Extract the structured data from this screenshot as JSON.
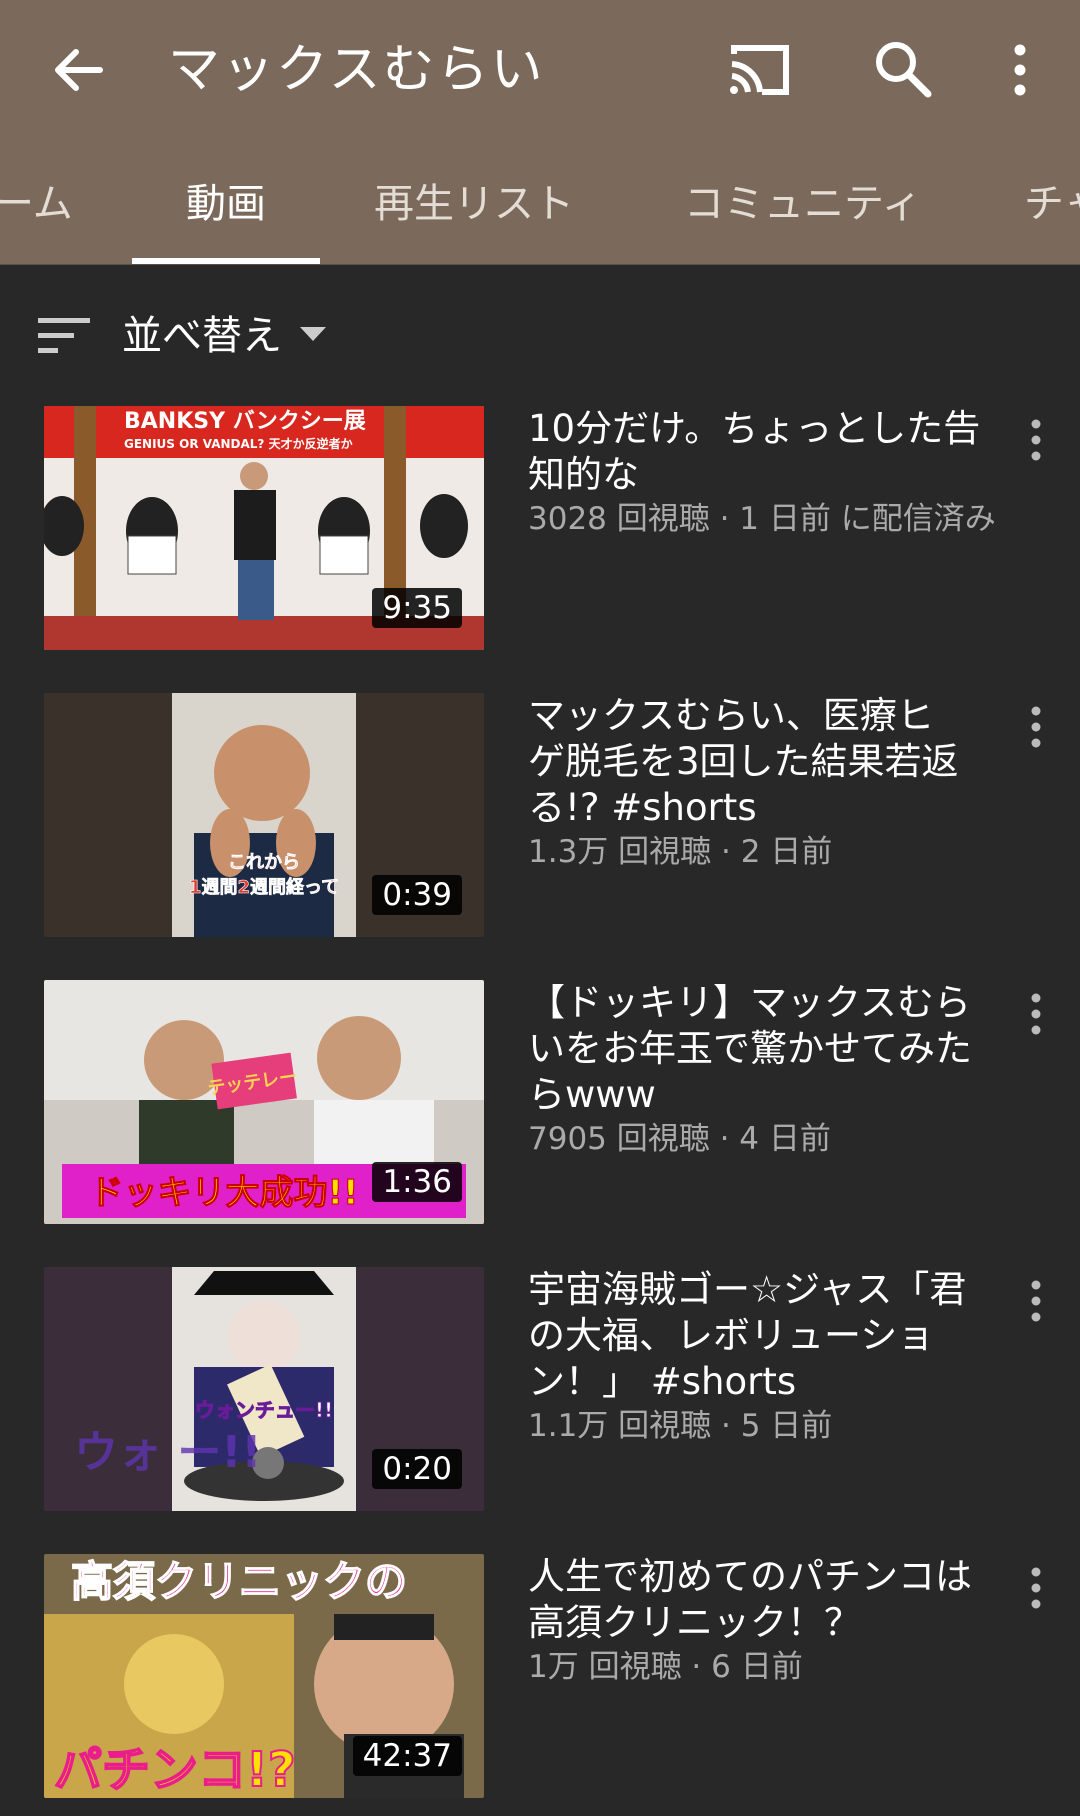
{
  "header": {
    "title": "マックスむらい",
    "bg_color": "#7b6a5b"
  },
  "tabs": [
    {
      "label": "ーム"
    },
    {
      "label": "動画"
    },
    {
      "label": "再生リスト"
    },
    {
      "label": "コミュニティ"
    },
    {
      "label": "チャ"
    }
  ],
  "active_tab": "動画",
  "sort": {
    "label": "並べ替え"
  },
  "videos": [
    {
      "title": "10分だけ。ちょっとした告知的な",
      "title_lines": [
        "10分だけ。ちょっとした告",
        "知的な"
      ],
      "meta": "3028 回視聴 · 1 日前 に配信済み",
      "duration": "9:35",
      "thumb_text_1": "BANKSY バンクシー展",
      "thumb_text_2": "GENIUS OR VANDAL? 天才か反逆者か"
    },
    {
      "title": "マックスむらい、医療ヒゲ脱毛を3回した結果若返る!? #shorts",
      "title_lines": [
        "マックスむらい、医療ヒ",
        "ゲ脱毛を3回した結果若返",
        "る!? #shorts"
      ],
      "meta": "1.3万 回視聴 · 2 日前",
      "duration": "0:39",
      "thumb_text_1": "これから",
      "thumb_text_2": "1週間2週間経って"
    },
    {
      "title": "【ドッキリ】マックスむらいをお年玉で驚かせてみたらwww",
      "title_lines": [
        "【ドッキリ】マックスむら",
        "いをお年玉で驚かせてみた",
        "らwww"
      ],
      "meta": "7905 回視聴 · 4 日前",
      "duration": "1:36",
      "thumb_text_1": "テッテレー",
      "thumb_text_2": "ドッキリ大成功!!"
    },
    {
      "title": "宇宙海賊ゴー☆ジャス「君の大福、レボリューション！」 #shorts",
      "title_lines": [
        "宇宙海賊ゴー☆ジャス「君",
        "の大福、レボリューショ",
        "ン！」 #shorts"
      ],
      "meta": "1.1万 回視聴 · 5 日前",
      "duration": "0:20",
      "thumb_text_1": "ウォンチュー!!",
      "thumb_text_2": "ウォ ー!!"
    },
    {
      "title": "人生で初めてのパチンコは高須クリニック！？",
      "title_lines": [
        "人生で初めてのパチンコは",
        "高須クリニック！？"
      ],
      "meta": "1万 回視聴 · 6 日前",
      "duration": "42:37",
      "thumb_text_1": "高須クリニックの",
      "thumb_text_2": "パチンコ!?"
    }
  ],
  "icons": {
    "back": "arrow-back-icon",
    "cast": "cast-icon",
    "search": "search-icon",
    "more": "more-vert-icon",
    "sort": "sort-icon",
    "caret": "caret-down-icon"
  }
}
